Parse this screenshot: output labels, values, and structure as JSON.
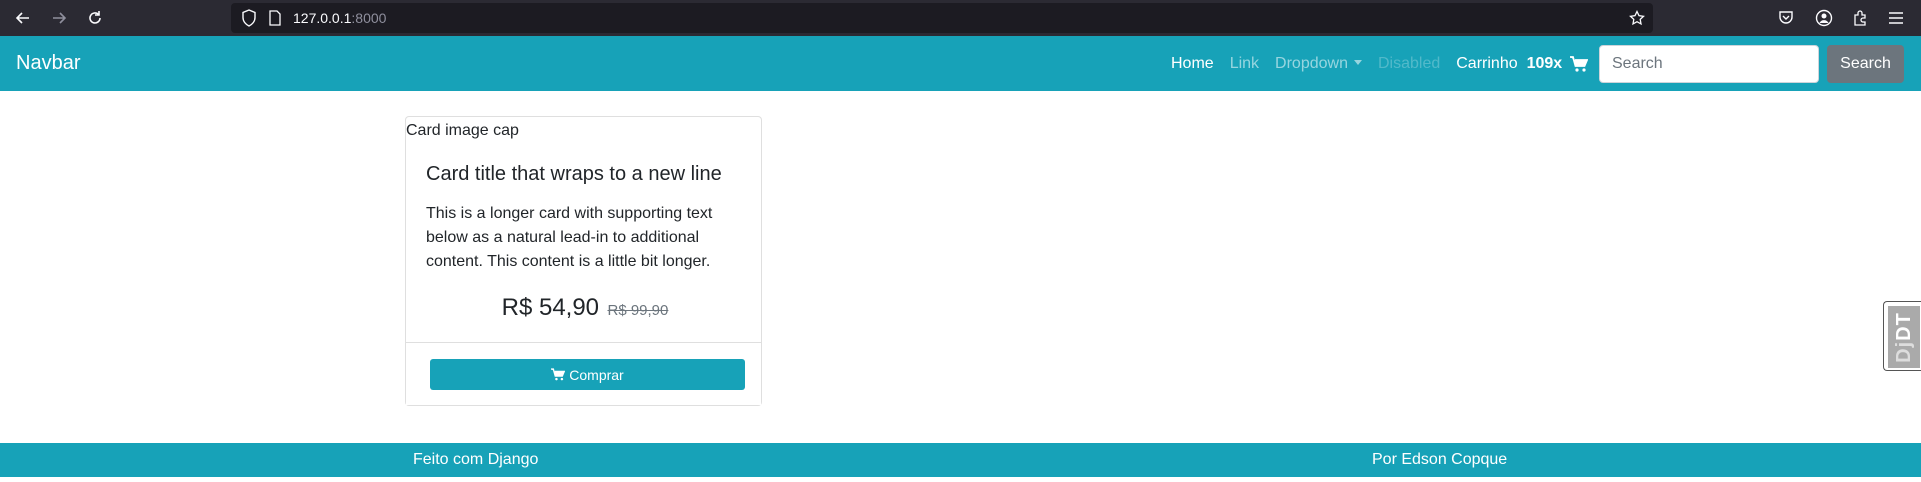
{
  "browser": {
    "url_host": "127.0.0.1",
    "url_port": ":8000"
  },
  "navbar": {
    "brand": "Navbar",
    "links": {
      "home": "Home",
      "link": "Link",
      "dropdown": "Dropdown",
      "disabled": "Disabled"
    },
    "cart": {
      "label": "Carrinho",
      "count": "109x"
    },
    "search": {
      "placeholder": "Search",
      "value": "",
      "button_label": "Search"
    }
  },
  "card": {
    "image_alt": "Card image cap",
    "title": "Card title that wraps to a new line",
    "text": "This is a longer card with supporting text below as a natural lead-in to additional content. This content is a little bit longer.",
    "price": "R$ 54,90",
    "old_price": "R$ 99,90",
    "buy_label": "Comprar"
  },
  "debug_toolbar": {
    "label_dj": "Dj",
    "label_dt": "DT"
  },
  "footer": {
    "left": "Feito com Django",
    "right": "Por Edson Copque"
  },
  "colors": {
    "primary": "#17a2b8",
    "secondary": "#6c757d",
    "browser_chrome": "#2b2a33"
  },
  "icons": {
    "back": "arrow-left-icon",
    "forward": "arrow-right-icon",
    "reload": "reload-icon",
    "shield": "shield-icon",
    "page": "page-icon",
    "bookmark": "star-icon",
    "pocket": "pocket-icon",
    "account": "account-icon",
    "extensions": "extensions-icon",
    "menu": "hamburger-menu-icon",
    "cart": "shopping-cart-icon"
  }
}
